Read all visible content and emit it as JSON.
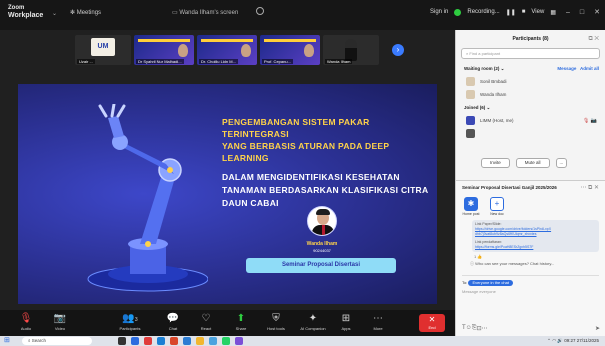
{
  "topbar": {
    "brand_line1": "Zoom",
    "brand_line2": "Workplace",
    "meetings": "Meetings",
    "window_title": "Wanda Ilham's screen",
    "sign_in": "Sign in",
    "recording": "Recording...",
    "view": "View"
  },
  "strip": {
    "tiles": [
      {
        "name": "Uzair ..."
      },
      {
        "name": "Dr Syahril Nur Malhadi..."
      },
      {
        "name": "Dr. Cholilu Lidn M..."
      },
      {
        "name": "Prof. Cepanu..."
      },
      {
        "name": "Wanda Ilham"
      }
    ]
  },
  "slide": {
    "title_yellow_1": "PENGEMBANGAN SISTEM PAKAR TERINTEGRASI",
    "title_yellow_2": "YANG BERBASIS ATURAN PADA DEEP LEARNING",
    "title_white_1": "DALAM MENGIDENTIFIKASI KESEHATAN",
    "title_white_2": "TANAMAN BERDASARKAN KLASIFIKASI CITRA",
    "title_white_3": "DAUN CABAI",
    "speaker_name": "Wanda Ilham",
    "speaker_id": "90244037",
    "badge": "Seminar Proposal Disertasi"
  },
  "toolbar": {
    "items": [
      {
        "label": "Audio",
        "icon": "microphone-icon"
      },
      {
        "label": "Video",
        "icon": "camera-icon"
      },
      {
        "label": "Participants",
        "icon": "people-icon",
        "count": "3"
      },
      {
        "label": "Chat",
        "icon": "chat-icon"
      },
      {
        "label": "React",
        "icon": "heart-icon"
      },
      {
        "label": "Share",
        "icon": "share-icon"
      },
      {
        "label": "Host tools",
        "icon": "shield-icon"
      },
      {
        "label": "AI Companion",
        "icon": "ai-icon"
      },
      {
        "label": "Apps",
        "icon": "apps-icon"
      },
      {
        "label": "More",
        "icon": "more-icon"
      }
    ],
    "end": "End"
  },
  "participants": {
    "title": "Participants (8)",
    "search_placeholder": "Find a participant",
    "waiting_title": "Waiting room (2)",
    "message": "Message",
    "admit_all": "Admit all",
    "waiting": [
      "Sonil Bmbadi",
      "Wanda Ilham"
    ],
    "joined_title": "Joined (6)",
    "joined": [
      "LIMM (Host, me)",
      ""
    ],
    "invite": "Invite",
    "mute_all": "Mute all",
    "more": "..."
  },
  "chat": {
    "title": "Seminar Proposal Disertasi Ganjil 2025/2026",
    "tab_home": "Home post",
    "tab_new": "New doc",
    "msg_intro": "Link Paper/Slide:",
    "msg_link1": "https://drive.google.com/drive/folders/1sPhdLxpX",
    "msg_link2": "dhb7j3vat8ub9z8aQs6fKUlqmr_xhxxtes",
    "msg_intro2": "Link pendaftaran:",
    "msg_link3": "https://forms.gle/PcaH8ESrZgxh5S7F",
    "reactions": "1 👍",
    "quote": "Who can see your messages? Chat history...",
    "to_label": "To:",
    "to_value": "Everyone in the chat",
    "placeholder": "Message everyone"
  },
  "taskbar": {
    "search": "Search",
    "time": "09:27",
    "date": "27/11/2025"
  },
  "colors": {
    "slide_bg": "#2a2f8f",
    "accent_yellow": "#ffd34a",
    "badge_bg": "#8fdcf7",
    "zoom_blue": "#2d6cdf",
    "end_red": "#e02f2f"
  }
}
